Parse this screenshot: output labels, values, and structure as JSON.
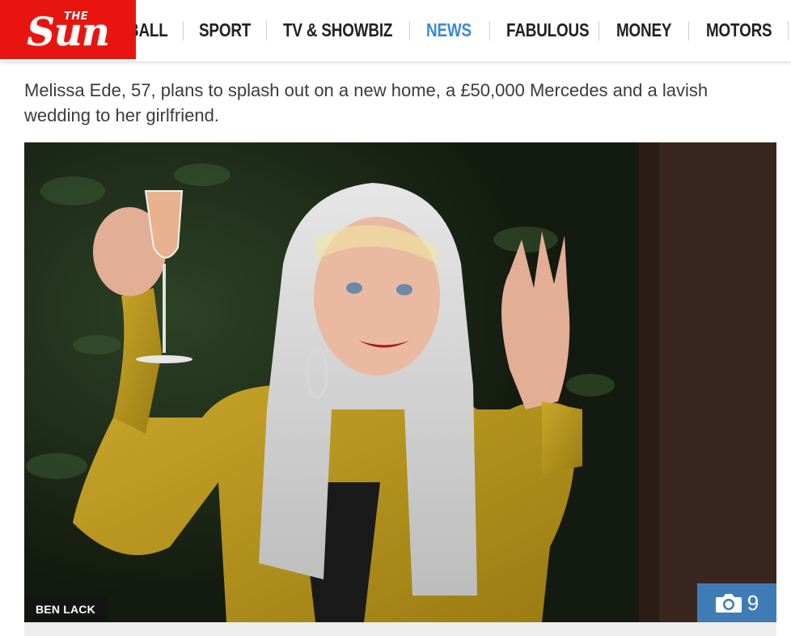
{
  "brand": {
    "logo_small": "THE",
    "logo_main": "Sun",
    "color": "#e8140f"
  },
  "nav": {
    "items": [
      {
        "label": "BALL",
        "active": false
      },
      {
        "label": "SPORT",
        "active": false
      },
      {
        "label": "TV & SHOWBIZ",
        "active": false
      },
      {
        "label": "NEWS",
        "active": true
      },
      {
        "label": "FABULOUS",
        "active": false
      },
      {
        "label": "MONEY",
        "active": false
      },
      {
        "label": "MOTORS",
        "active": false
      }
    ],
    "active_color": "#3a8bd4"
  },
  "article": {
    "standfirst": "Melissa Ede, 57, plans to splash out on a new home, a £50,000 Mercedes and a lavish wedding to her girlfriend.",
    "image": {
      "credit": "BEN LACK",
      "gallery_icon": "camera-icon",
      "gallery_count": "9"
    }
  }
}
